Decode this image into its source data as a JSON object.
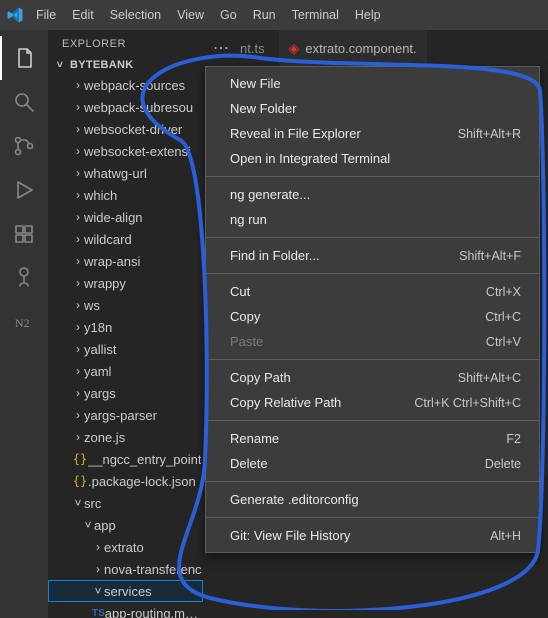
{
  "menu": {
    "items": [
      "File",
      "Edit",
      "Selection",
      "View",
      "Go",
      "Run",
      "Terminal",
      "Help"
    ]
  },
  "activitybar": {
    "items": [
      {
        "name": "explorer",
        "active": true
      },
      {
        "name": "search"
      },
      {
        "name": "source-control"
      },
      {
        "name": "run-debug"
      },
      {
        "name": "extensions"
      },
      {
        "name": "tree-icon"
      },
      {
        "name": "n2"
      }
    ]
  },
  "sidebar": {
    "title": "EXPLORER",
    "section": "BYTEBANK",
    "tree": [
      {
        "d": 1,
        "t": "folder",
        "e": false,
        "l": "webpack-sources"
      },
      {
        "d": 1,
        "t": "folder",
        "e": false,
        "l": "webpack-subresou"
      },
      {
        "d": 1,
        "t": "folder",
        "e": false,
        "l": "websocket-driver"
      },
      {
        "d": 1,
        "t": "folder",
        "e": false,
        "l": "websocket-extensi"
      },
      {
        "d": 1,
        "t": "folder",
        "e": false,
        "l": "whatwg-url"
      },
      {
        "d": 1,
        "t": "folder",
        "e": false,
        "l": "which"
      },
      {
        "d": 1,
        "t": "folder",
        "e": false,
        "l": "wide-align"
      },
      {
        "d": 1,
        "t": "folder",
        "e": false,
        "l": "wildcard"
      },
      {
        "d": 1,
        "t": "folder",
        "e": false,
        "l": "wrap-ansi"
      },
      {
        "d": 1,
        "t": "folder",
        "e": false,
        "l": "wrappy"
      },
      {
        "d": 1,
        "t": "folder",
        "e": false,
        "l": "ws"
      },
      {
        "d": 1,
        "t": "folder",
        "e": false,
        "l": "y18n"
      },
      {
        "d": 1,
        "t": "folder",
        "e": false,
        "l": "yallist"
      },
      {
        "d": 1,
        "t": "folder",
        "e": false,
        "l": "yaml"
      },
      {
        "d": 1,
        "t": "folder",
        "e": false,
        "l": "yargs"
      },
      {
        "d": 1,
        "t": "folder",
        "e": false,
        "l": "yargs-parser"
      },
      {
        "d": 1,
        "t": "folder",
        "e": false,
        "l": "zone.js"
      },
      {
        "d": 1,
        "t": "json",
        "l": "__ngcc_entry_point"
      },
      {
        "d": 1,
        "t": "json",
        "l": ".package-lock.json"
      },
      {
        "d": 1,
        "t": "folder",
        "e": true,
        "l": "src"
      },
      {
        "d": 2,
        "t": "folder",
        "e": true,
        "l": "app"
      },
      {
        "d": 3,
        "t": "folder",
        "e": false,
        "l": "extrato"
      },
      {
        "d": 3,
        "t": "folder",
        "e": false,
        "l": "nova-transferenc"
      },
      {
        "d": 3,
        "t": "folder",
        "e": true,
        "l": "services",
        "sel": true
      },
      {
        "d": 3,
        "t": "ts",
        "l": "app-routing.module.ts"
      }
    ]
  },
  "tabs": {
    "overflow_label": "nt.ts",
    "active": {
      "label": "extrato.component."
    }
  },
  "context_menu": [
    {
      "type": "item",
      "label": "New File"
    },
    {
      "type": "item",
      "label": "New Folder"
    },
    {
      "type": "item",
      "label": "Reveal in File Explorer",
      "shortcut": "Shift+Alt+R"
    },
    {
      "type": "item",
      "label": "Open in Integrated Terminal"
    },
    {
      "type": "sep"
    },
    {
      "type": "item",
      "label": "ng generate..."
    },
    {
      "type": "item",
      "label": "ng run"
    },
    {
      "type": "sep"
    },
    {
      "type": "item",
      "label": "Find in Folder...",
      "shortcut": "Shift+Alt+F"
    },
    {
      "type": "sep"
    },
    {
      "type": "item",
      "label": "Cut",
      "shortcut": "Ctrl+X"
    },
    {
      "type": "item",
      "label": "Copy",
      "shortcut": "Ctrl+C"
    },
    {
      "type": "item",
      "label": "Paste",
      "shortcut": "Ctrl+V",
      "disabled": true
    },
    {
      "type": "sep"
    },
    {
      "type": "item",
      "label": "Copy Path",
      "shortcut": "Shift+Alt+C"
    },
    {
      "type": "item",
      "label": "Copy Relative Path",
      "shortcut": "Ctrl+K Ctrl+Shift+C"
    },
    {
      "type": "sep"
    },
    {
      "type": "item",
      "label": "Rename",
      "shortcut": "F2"
    },
    {
      "type": "item",
      "label": "Delete",
      "shortcut": "Delete"
    },
    {
      "type": "sep"
    },
    {
      "type": "item",
      "label": "Generate .editorconfig"
    },
    {
      "type": "sep"
    },
    {
      "type": "item",
      "label": "Git: View File History",
      "shortcut": "Alt+H"
    }
  ]
}
